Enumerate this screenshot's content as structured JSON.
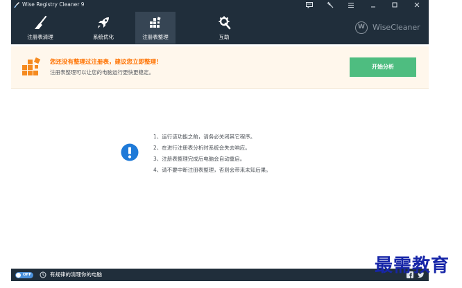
{
  "window": {
    "title": "Wise Registry Cleaner 9",
    "controls": [
      "feedback-icon",
      "tools-icon",
      "menu-icon",
      "minimize-icon",
      "maximize-icon",
      "close-icon"
    ]
  },
  "nav": {
    "tabs": [
      {
        "label": "注册表清理",
        "icon": "broom-icon",
        "active": false
      },
      {
        "label": "系统优化",
        "icon": "rocket-icon",
        "active": false
      },
      {
        "label": "注册表整理",
        "icon": "blocks-icon",
        "active": true
      },
      {
        "label": "互助",
        "icon": "wrench-icon",
        "active": false
      }
    ],
    "brand": "WiseCleaner",
    "brand_mark": "W"
  },
  "banner": {
    "title": "您还没有整理过注册表，建议您立即整理！",
    "subtitle": "注册表整理可以让您的电脑运行更快更稳定。",
    "button_label": "开始分析",
    "colors": {
      "title": "#ff7200",
      "button": "#4ebd80",
      "background": "#fff7ec"
    }
  },
  "notice": {
    "items": [
      "1、运行该功能之前，请务必关闭其它程序。",
      "2、在进行注册表分析时系统会失去响应。",
      "3、注册表整理完成后电脑会自动重启。",
      "4、请不要中断注册表整理，否则会带来未知后果。"
    ],
    "icon": "info-icon"
  },
  "statusbar": {
    "toggle_label": "OFF",
    "label": "有规律的清理你的电脑",
    "icons": [
      "clock-icon",
      "facebook-icon",
      "twitter-icon"
    ]
  },
  "watermark": "最需教育",
  "colors": {
    "titlebar": "#202e3b",
    "active_tab": "#364554",
    "accent": "#4ebd80"
  }
}
